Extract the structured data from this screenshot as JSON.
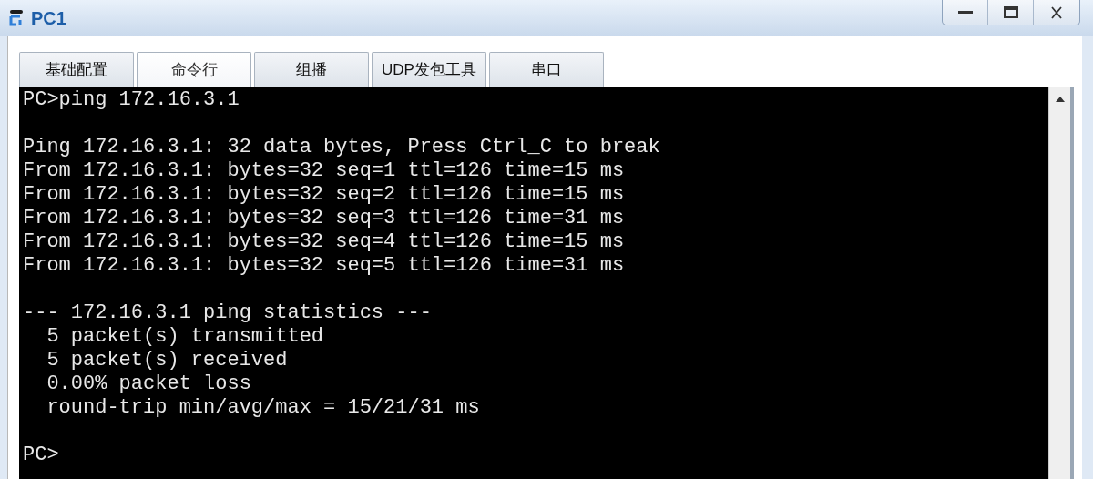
{
  "window": {
    "title": "PC1"
  },
  "tabs": [
    {
      "label": "基础配置",
      "selected": false
    },
    {
      "label": "命令行",
      "selected": true
    },
    {
      "label": "组播",
      "selected": false
    },
    {
      "label": "UDP发包工具",
      "selected": false
    },
    {
      "label": "串口",
      "selected": false
    }
  ],
  "terminal": {
    "blocks": [
      [
        "PC>ping 172.16.3.1"
      ],
      [
        "Ping 172.16.3.1: 32 data bytes, Press Ctrl_C to break",
        "From 172.16.3.1: bytes=32 seq=1 ttl=126 time=15 ms",
        "From 172.16.3.1: bytes=32 seq=2 ttl=126 time=15 ms",
        "From 172.16.3.1: bytes=32 seq=3 ttl=126 time=31 ms",
        "From 172.16.3.1: bytes=32 seq=4 ttl=126 time=15 ms",
        "From 172.16.3.1: bytes=32 seq=5 ttl=126 time=31 ms"
      ],
      [
        "--- 172.16.3.1 ping statistics ---",
        "  5 packet(s) transmitted",
        "  5 packet(s) received",
        "  0.00% packet loss",
        "  round-trip min/avg/max = 15/21/31 ms"
      ],
      [
        "PC>"
      ]
    ]
  }
}
